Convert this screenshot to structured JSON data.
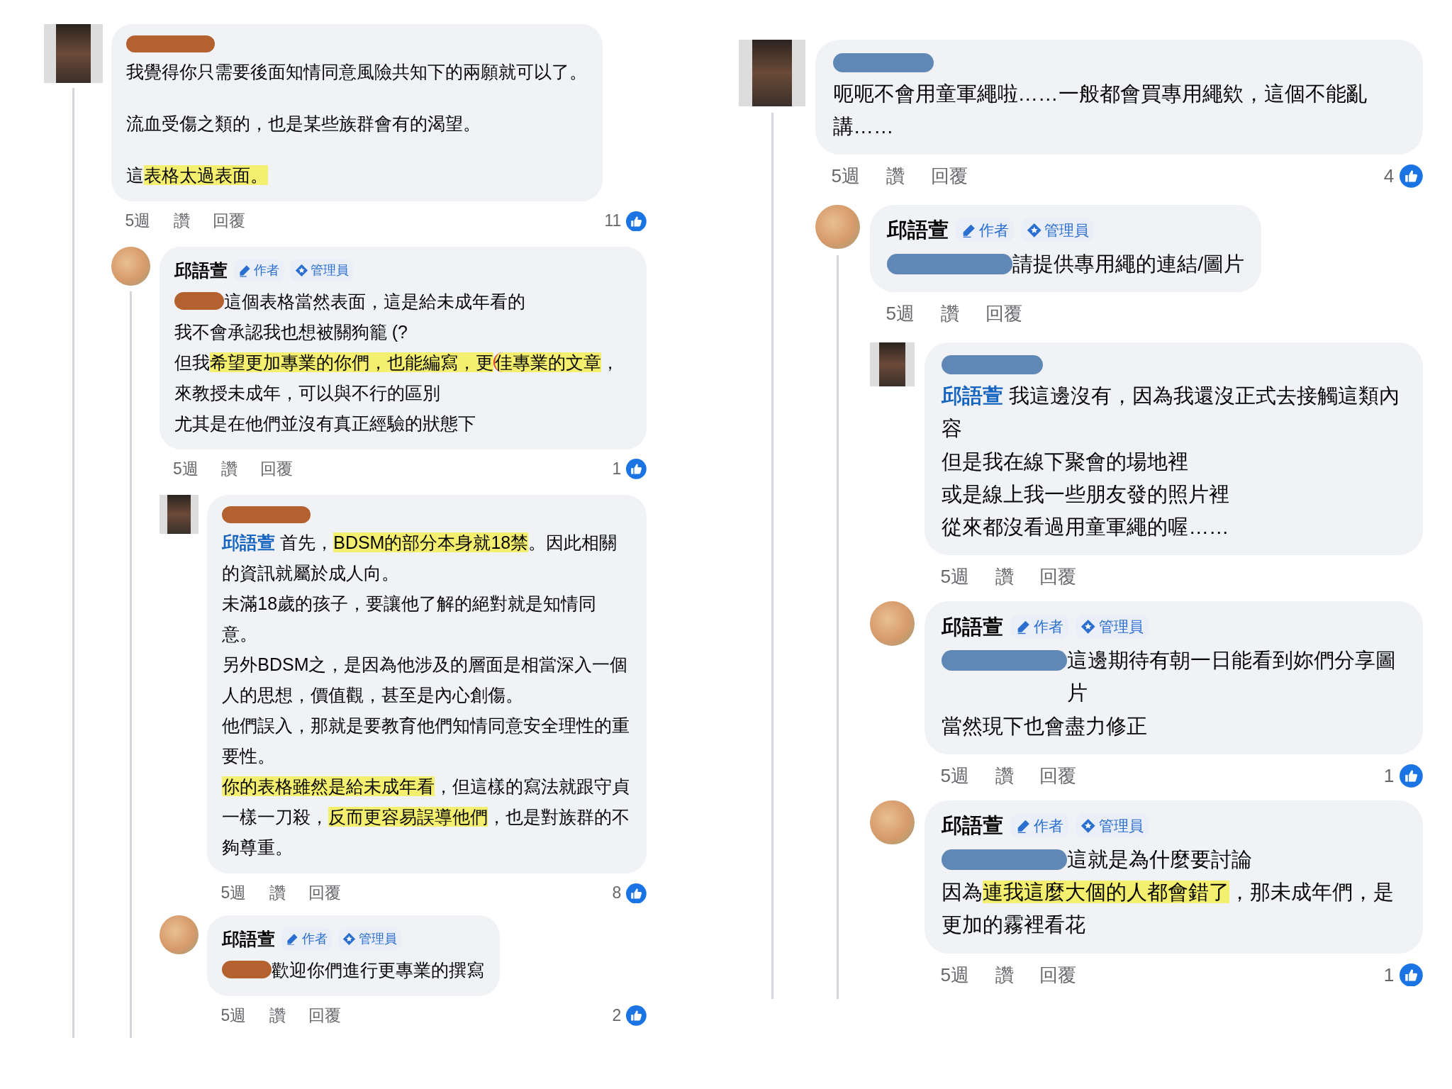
{
  "panels": [
    {
      "color": "#b3622f",
      "comments": [
        {
          "avatar": {
            "kind": "pixelated"
          },
          "name_redacted": true,
          "spaced": true,
          "paragraphs": [
            {
              "segments": [
                {
                  "text": "我覺得你只需要後面知情同意風險共知下的兩願就可以了。",
                  "kind": "plain"
                }
              ]
            },
            {
              "segments": [
                {
                  "text": "流血受傷之類的，也是某些族群會有的渴望。",
                  "kind": "plain"
                }
              ]
            },
            {
              "segments": [
                {
                  "text": "這",
                  "kind": "plain"
                },
                {
                  "text": "表格太過表面。",
                  "kind": "highlight"
                }
              ]
            }
          ],
          "time": "5週",
          "like": "讚",
          "reply": "回覆",
          "reactions": "11",
          "children": [
            {
              "avatar": {
                "kind": "round"
              },
              "author": "邱語萱",
              "badges": [
                {
                  "kind": "pencil",
                  "label": "作者"
                },
                {
                  "kind": "diamond",
                  "label": "管理員"
                }
              ],
              "paragraphs": [
                {
                  "redacted_prefix": true,
                  "segments": [
                    {
                      "text": "這個表格當然表面，這是給未成年看的",
                      "kind": "plain"
                    }
                  ]
                },
                {
                  "segments": [
                    {
                      "text": "我不會承認我也想被關狗籠 (?",
                      "kind": "plain"
                    }
                  ]
                },
                {
                  "segments": [
                    {
                      "text": "但我",
                      "kind": "plain"
                    },
                    {
                      "text": "希望更加專業的你們，也能編寫，更",
                      "kind": "highlight"
                    },
                    {
                      "text": "佳",
                      "kind": "circled"
                    },
                    {
                      "text": "專業的文章",
                      "kind": "highlight"
                    },
                    {
                      "text": "，來教授未成年，可以與不行的區別",
                      "kind": "plain"
                    }
                  ]
                },
                {
                  "segments": [
                    {
                      "text": "尤其是在他們並沒有真正經驗的狀態下",
                      "kind": "plain"
                    }
                  ]
                }
              ],
              "time": "5週",
              "like": "讚",
              "reply": "回覆",
              "reactions": "1",
              "children": [
                {
                  "avatar": {
                    "kind": "pixelated"
                  },
                  "name_redacted": true,
                  "paragraphs": [
                    {
                      "segments": [
                        {
                          "text": "邱語萱",
                          "kind": "mention"
                        },
                        {
                          "text": " 首先，",
                          "kind": "plain"
                        },
                        {
                          "text": "BDSM的部分本身就18禁",
                          "kind": "highlight"
                        },
                        {
                          "text": "。因此相關的資訊就屬於成人向。",
                          "kind": "plain"
                        }
                      ]
                    },
                    {
                      "segments": [
                        {
                          "text": "未滿18歲的孩子，要讓他了解的絕對就是知情同意。",
                          "kind": "plain"
                        }
                      ]
                    },
                    {
                      "segments": [
                        {
                          "text": "另外BDSM之，是因為他涉及的層面是相當深入一個人的思想，價值觀，甚至是內心創傷。",
                          "kind": "plain"
                        }
                      ]
                    },
                    {
                      "segments": [
                        {
                          "text": "他們誤入，那就是要教育他們知情同意安全理性的重要性。",
                          "kind": "plain"
                        }
                      ]
                    },
                    {
                      "segments": [
                        {
                          "text": "你的表格雖然是給未成年看",
                          "kind": "highlight"
                        },
                        {
                          "text": "，但這樣的寫法就跟守貞一樣一刀殺，",
                          "kind": "plain"
                        },
                        {
                          "text": "反而更容易誤導他們",
                          "kind": "highlight"
                        },
                        {
                          "text": "，也是對族群的不夠尊重。",
                          "kind": "plain"
                        }
                      ]
                    }
                  ],
                  "time": "5週",
                  "like": "讚",
                  "reply": "回覆",
                  "reactions": "8"
                },
                {
                  "avatar": {
                    "kind": "round"
                  },
                  "author": "邱語萱",
                  "badges": [
                    {
                      "kind": "pencil",
                      "label": "作者"
                    },
                    {
                      "kind": "diamond",
                      "label": "管理員"
                    }
                  ],
                  "paragraphs": [
                    {
                      "redacted_prefix": true,
                      "segments": [
                        {
                          "text": "歡迎你們進行更專業的撰寫",
                          "kind": "plain"
                        }
                      ]
                    }
                  ],
                  "time": "5週",
                  "like": "讚",
                  "reply": "回覆",
                  "reactions": "2"
                }
              ]
            }
          ]
        }
      ]
    },
    {
      "color": "#5f88b6",
      "comments": [
        {
          "avatar": {
            "kind": "pixelated"
          },
          "name_redacted": true,
          "paragraphs": [
            {
              "segments": [
                {
                  "text": "呃呃不會用童軍繩啦……一般都會買專用繩欸，這個不能亂講……",
                  "kind": "plain"
                }
              ]
            }
          ],
          "time": "5週",
          "like": "讚",
          "reply": "回覆",
          "reactions": "4",
          "children": [
            {
              "avatar": {
                "kind": "round"
              },
              "author": "邱語萱",
              "badges": [
                {
                  "kind": "pencil",
                  "label": "作者"
                },
                {
                  "kind": "diamond",
                  "label": "管理員"
                }
              ],
              "paragraphs": [
                {
                  "redacted_prefix": true,
                  "segments": [
                    {
                      "text": "請提供專用繩的連結/圖片",
                      "kind": "plain"
                    }
                  ]
                }
              ],
              "time": "5週",
              "like": "讚",
              "reply": "回覆",
              "children": [
                {
                  "avatar": {
                    "kind": "pixelated"
                  },
                  "name_redacted": true,
                  "paragraphs": [
                    {
                      "segments": [
                        {
                          "text": "邱語萱",
                          "kind": "mention"
                        },
                        {
                          "text": " 我這邊沒有，因為我還沒正式去接觸這類內容",
                          "kind": "plain"
                        }
                      ]
                    },
                    {
                      "segments": [
                        {
                          "text": "但是我在線下聚會的場地裡",
                          "kind": "plain"
                        }
                      ]
                    },
                    {
                      "segments": [
                        {
                          "text": "或是線上我一些朋友發的照片裡",
                          "kind": "plain"
                        }
                      ]
                    },
                    {
                      "segments": [
                        {
                          "text": "從來都沒看過用童軍繩的喔……",
                          "kind": "plain"
                        }
                      ]
                    }
                  ],
                  "time": "5週",
                  "like": "讚",
                  "reply": "回覆"
                },
                {
                  "avatar": {
                    "kind": "round"
                  },
                  "author": "邱語萱",
                  "badges": [
                    {
                      "kind": "pencil",
                      "label": "作者"
                    },
                    {
                      "kind": "diamond",
                      "label": "管理員"
                    }
                  ],
                  "paragraphs": [
                    {
                      "redacted_prefix": true,
                      "segments": [
                        {
                          "text": "這邊期待有朝一日能看到妳們分享圖片",
                          "kind": "plain"
                        }
                      ]
                    },
                    {
                      "segments": [
                        {
                          "text": "當然現下也會盡力修正",
                          "kind": "plain"
                        }
                      ]
                    }
                  ],
                  "time": "5週",
                  "like": "讚",
                  "reply": "回覆",
                  "reactions": "1"
                },
                {
                  "avatar": {
                    "kind": "round"
                  },
                  "author": "邱語萱",
                  "badges": [
                    {
                      "kind": "pencil",
                      "label": "作者"
                    },
                    {
                      "kind": "diamond",
                      "label": "管理員"
                    }
                  ],
                  "paragraphs": [
                    {
                      "redacted_prefix": true,
                      "segments": [
                        {
                          "text": "這就是為什麼要討論",
                          "kind": "plain"
                        }
                      ]
                    },
                    {
                      "segments": [
                        {
                          "text": "因為",
                          "kind": "plain"
                        },
                        {
                          "text": "連我這麼大個的人都會錯了",
                          "kind": "highlight"
                        },
                        {
                          "text": "，那未成年們，是更加的霧裡看花",
                          "kind": "plain"
                        }
                      ]
                    }
                  ],
                  "time": "5週",
                  "like": "讚",
                  "reply": "回覆",
                  "reactions": "1"
                }
              ]
            }
          ]
        }
      ]
    }
  ]
}
